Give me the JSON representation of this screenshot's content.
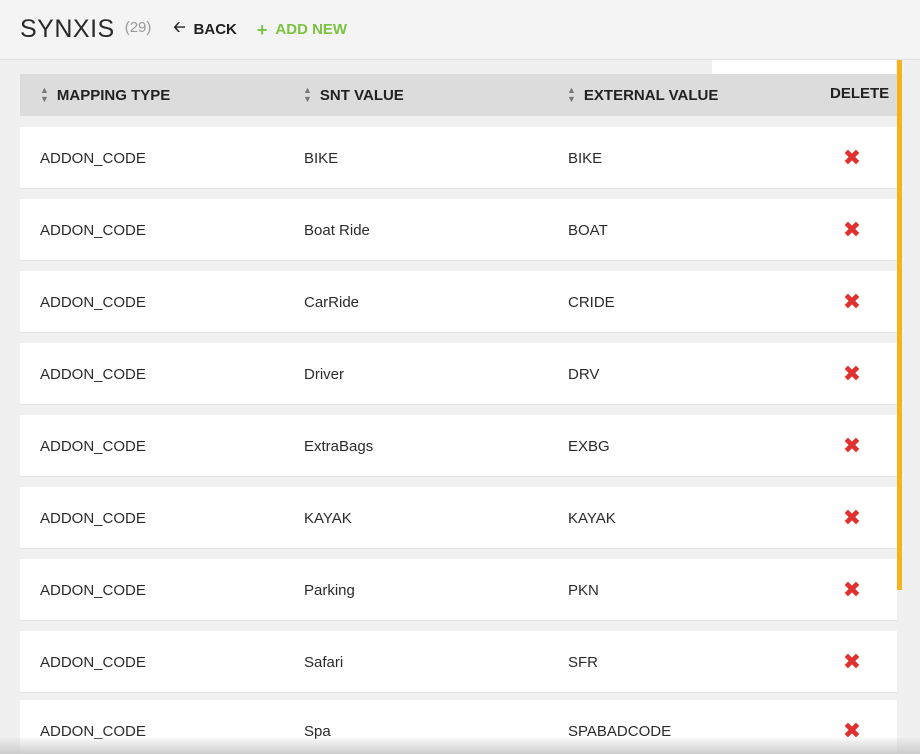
{
  "header": {
    "title": "SYNXIS",
    "count": "(29)",
    "back_label": "BACK",
    "add_label": "ADD NEW",
    "add_color": "#7cc242"
  },
  "table": {
    "columns": {
      "mapping_type": "MAPPING TYPE",
      "snt_value": "SNT VALUE",
      "external_value": "EXTERNAL VALUE",
      "delete": "DELETE"
    },
    "rows": [
      {
        "mapping_type": "ADDON_CODE",
        "snt_value": "BIKE",
        "external_value": "BIKE"
      },
      {
        "mapping_type": "ADDON_CODE",
        "snt_value": "Boat Ride",
        "external_value": "BOAT"
      },
      {
        "mapping_type": "ADDON_CODE",
        "snt_value": "CarRide",
        "external_value": "CRIDE"
      },
      {
        "mapping_type": "ADDON_CODE",
        "snt_value": "Driver",
        "external_value": "DRV"
      },
      {
        "mapping_type": "ADDON_CODE",
        "snt_value": "ExtraBags",
        "external_value": "EXBG"
      },
      {
        "mapping_type": "ADDON_CODE",
        "snt_value": "KAYAK",
        "external_value": "KAYAK"
      },
      {
        "mapping_type": "ADDON_CODE",
        "snt_value": "Parking",
        "external_value": "PKN"
      },
      {
        "mapping_type": "ADDON_CODE",
        "snt_value": "Safari",
        "external_value": "SFR"
      },
      {
        "mapping_type": "ADDON_CODE",
        "snt_value": "Spa",
        "external_value": "SPABADCODE"
      }
    ],
    "delete_icon_color": "#e03131",
    "scroll_accent": "#f6b21c"
  }
}
